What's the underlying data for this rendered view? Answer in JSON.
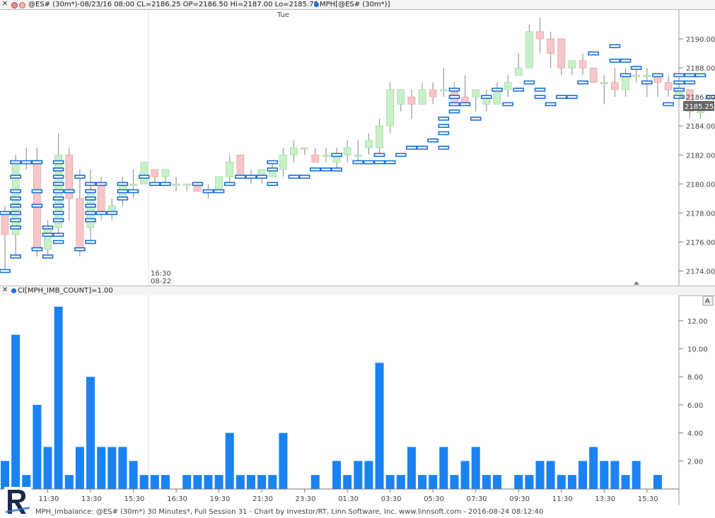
{
  "top_bar": {
    "symbol_info": "@ES# (30m*)-08/23/16 08:00 CL=2186.25 OP=2186.50 Hi=2187.00 Lo=2185.75",
    "indicator_info": "MPH[@ES# (30m*)]"
  },
  "price_panel": {
    "day_label": "Tue",
    "session_time": "16:30",
    "session_date": "08-22",
    "last_price": "2185.25",
    "y_ticks": [
      "2174.00",
      "2176.00",
      "2178.00",
      "2180.00",
      "2182.00",
      "2184.00",
      "2186.00",
      "2188.00",
      "2190.00"
    ]
  },
  "lower_bar": {
    "indicator_label": "CI[MPH_IMB_COUNT]=1.00",
    "auto_button": "A"
  },
  "footer": {
    "text": "MPH_Imbalance: @ES# (30m*) 30 Minutes*, Full Session 31 - Chart by Investor/RT, Linn Software, Inc. www.linnsoft.com - 2016-08-24 08:12:40"
  },
  "colors": {
    "up_candle": "#c8f0c8",
    "down_candle": "#f7c6c8",
    "marker": "#1a6fd8",
    "histogram": "#1a82f2"
  },
  "chart_data": [
    {
      "type": "candlestick",
      "ylim": [
        2173,
        2192
      ],
      "candles": [
        {
          "o": 2178.0,
          "h": 2178.5,
          "l": 2174.0,
          "c": 2176.5
        },
        {
          "o": 2176.5,
          "h": 2182.0,
          "l": 2175.0,
          "c": 2181.5
        },
        {
          "o": 2181.5,
          "h": 2182.5,
          "l": 2181.0,
          "c": 2181.5
        },
        {
          "o": 2181.5,
          "h": 2182.5,
          "l": 2175.0,
          "c": 2175.5
        },
        {
          "o": 2175.5,
          "h": 2177.5,
          "l": 2175.0,
          "c": 2177.0
        },
        {
          "o": 2177.0,
          "h": 2183.5,
          "l": 2176.5,
          "c": 2182.0
        },
        {
          "o": 2182.0,
          "h": 2182.5,
          "l": 2177.5,
          "c": 2179.0
        },
        {
          "o": 2179.0,
          "h": 2181.0,
          "l": 2175.0,
          "c": 2175.5
        },
        {
          "o": 2177.0,
          "h": 2181.0,
          "l": 2176.0,
          "c": 2179.5
        },
        {
          "o": 2180.0,
          "h": 2180.5,
          "l": 2177.5,
          "c": 2178.0
        },
        {
          "o": 2178.0,
          "h": 2179.0,
          "l": 2177.5,
          "c": 2178.5
        },
        {
          "o": 2179.0,
          "h": 2180.5,
          "l": 2178.5,
          "c": 2180.0
        },
        {
          "o": 2180.0,
          "h": 2181.0,
          "l": 2179.0,
          "c": 2180.0
        },
        {
          "o": 2180.0,
          "h": 2181.5,
          "l": 2180.0,
          "c": 2181.5
        },
        {
          "o": 2181.0,
          "h": 2181.0,
          "l": 2180.0,
          "c": 2180.5
        },
        {
          "o": 2180.5,
          "h": 2181.0,
          "l": 2180.0,
          "c": 2181.0
        },
        {
          "o": 2180.0,
          "h": 2180.5,
          "l": 2179.5,
          "c": 2180.0
        },
        {
          "o": 2180.0,
          "h": 2180.0,
          "l": 2179.5,
          "c": 2180.0
        },
        {
          "o": 2180.0,
          "h": 2180.0,
          "l": 2179.5,
          "c": 2179.5
        },
        {
          "o": 2179.5,
          "h": 2180.0,
          "l": 2179.0,
          "c": 2179.5
        },
        {
          "o": 2179.5,
          "h": 2180.5,
          "l": 2179.5,
          "c": 2180.5
        },
        {
          "o": 2180.5,
          "h": 2182.0,
          "l": 2180.0,
          "c": 2181.5
        },
        {
          "o": 2182.0,
          "h": 2182.0,
          "l": 2180.5,
          "c": 2180.5
        },
        {
          "o": 2180.5,
          "h": 2181.0,
          "l": 2180.0,
          "c": 2180.5
        },
        {
          "o": 2180.5,
          "h": 2181.0,
          "l": 2180.0,
          "c": 2181.0
        },
        {
          "o": 2180.5,
          "h": 2181.5,
          "l": 2180.5,
          "c": 2181.0
        },
        {
          "o": 2181.0,
          "h": 2182.5,
          "l": 2180.5,
          "c": 2182.0
        },
        {
          "o": 2182.0,
          "h": 2183.0,
          "l": 2181.5,
          "c": 2182.5
        },
        {
          "o": 2182.5,
          "h": 2182.5,
          "l": 2182.0,
          "c": 2182.5
        },
        {
          "o": 2182.0,
          "h": 2182.5,
          "l": 2181.5,
          "c": 2181.5
        },
        {
          "o": 2182.0,
          "h": 2182.5,
          "l": 2181.5,
          "c": 2182.0
        },
        {
          "o": 2181.5,
          "h": 2182.5,
          "l": 2181.0,
          "c": 2182.0
        },
        {
          "o": 2182.0,
          "h": 2183.0,
          "l": 2181.5,
          "c": 2182.5
        },
        {
          "o": 2182.0,
          "h": 2183.0,
          "l": 2181.5,
          "c": 2182.0
        },
        {
          "o": 2182.5,
          "h": 2183.5,
          "l": 2182.0,
          "c": 2183.0
        },
        {
          "o": 2182.5,
          "h": 2184.5,
          "l": 2182.0,
          "c": 2184.0
        },
        {
          "o": 2184.0,
          "h": 2187.0,
          "l": 2183.5,
          "c": 2186.5
        },
        {
          "o": 2185.5,
          "h": 2186.5,
          "l": 2185.0,
          "c": 2186.5
        },
        {
          "o": 2186.0,
          "h": 2186.5,
          "l": 2184.5,
          "c": 2185.5
        },
        {
          "o": 2185.5,
          "h": 2187.0,
          "l": 2185.5,
          "c": 2186.5
        },
        {
          "o": 2186.5,
          "h": 2187.0,
          "l": 2185.5,
          "c": 2186.0
        },
        {
          "o": 2186.5,
          "h": 2188.0,
          "l": 2186.0,
          "c": 2186.5
        },
        {
          "o": 2186.5,
          "h": 2187.0,
          "l": 2185.5,
          "c": 2185.5
        },
        {
          "o": 2186.0,
          "h": 2187.5,
          "l": 2185.5,
          "c": 2185.5
        },
        {
          "o": 2186.0,
          "h": 2186.5,
          "l": 2185.0,
          "c": 2186.5
        },
        {
          "o": 2185.5,
          "h": 2186.5,
          "l": 2185.0,
          "c": 2186.0
        },
        {
          "o": 2185.5,
          "h": 2187.0,
          "l": 2185.5,
          "c": 2186.5
        },
        {
          "o": 2186.5,
          "h": 2187.5,
          "l": 2186.0,
          "c": 2187.0
        },
        {
          "o": 2187.5,
          "h": 2189.0,
          "l": 2187.5,
          "c": 2188.0
        },
        {
          "o": 2188.0,
          "h": 2191.0,
          "l": 2188.0,
          "c": 2190.5
        },
        {
          "o": 2190.5,
          "h": 2191.5,
          "l": 2189.0,
          "c": 2190.0
        },
        {
          "o": 2190.0,
          "h": 2190.5,
          "l": 2188.0,
          "c": 2189.0
        },
        {
          "o": 2190.0,
          "h": 2190.0,
          "l": 2187.5,
          "c": 2188.0
        },
        {
          "o": 2188.0,
          "h": 2188.5,
          "l": 2187.5,
          "c": 2188.5
        },
        {
          "o": 2188.5,
          "h": 2189.0,
          "l": 2187.5,
          "c": 2188.0
        },
        {
          "o": 2188.0,
          "h": 2188.0,
          "l": 2187.0,
          "c": 2187.0
        },
        {
          "o": 2187.0,
          "h": 2187.5,
          "l": 2185.5,
          "c": 2187.0
        },
        {
          "o": 2187.0,
          "h": 2188.0,
          "l": 2186.0,
          "c": 2186.5
        },
        {
          "o": 2186.5,
          "h": 2188.0,
          "l": 2186.0,
          "c": 2187.5
        },
        {
          "o": 2187.5,
          "h": 2188.0,
          "l": 2187.0,
          "c": 2187.5
        },
        {
          "o": 2187.5,
          "h": 2188.0,
          "l": 2186.0,
          "c": 2187.5
        },
        {
          "o": 2187.5,
          "h": 2187.5,
          "l": 2186.0,
          "c": 2187.0
        },
        {
          "o": 2187.0,
          "h": 2187.5,
          "l": 2186.0,
          "c": 2186.5
        },
        {
          "o": 2186.0,
          "h": 2187.5,
          "l": 2186.0,
          "c": 2186.5
        },
        {
          "o": 2186.5,
          "h": 2186.5,
          "l": 2184.5,
          "c": 2185.0
        },
        {
          "o": 2185.0,
          "h": 2185.5,
          "l": 2184.5,
          "c": 2185.0
        }
      ],
      "markers": [
        [
          2174.0,
          2178.0
        ],
        [
          2175.0,
          2180.5,
          2179.5,
          2179.0,
          2178.5,
          2178.0,
          2177.5,
          2177.0,
          2178.0,
          2181.5
        ],
        [
          2181.5
        ],
        [
          2175.5,
          2175.5,
          2178.5,
          2179.5,
          2181.5,
          2181.5
        ],
        [
          2175.0,
          2177.0,
          2176.5
        ],
        [
          2176.0,
          2176.5,
          2178.0,
          2177.5,
          2178.5,
          2179.0,
          2179.5,
          2180.0,
          2180.5,
          2181.0,
          2181.5
        ],
        [
          2179.5
        ],
        [
          2175.5,
          2180.5
        ],
        [
          2176.0,
          2177.5,
          2178.0,
          2178.5,
          2179.0,
          2179.5,
          2180.0
        ],
        [
          2178.0,
          2180.0
        ],
        [
          2178.0
        ],
        [
          2179.0,
          2179.5,
          2180.0
        ],
        [
          2179.5
        ],
        [
          2180.5
        ],
        [
          2180.0
        ],
        [
          2180.0
        ],
        [],
        [],
        [
          2180.0
        ],
        [
          2179.5
        ],
        [
          2179.5
        ],
        [
          2180.0
        ],
        [
          2180.5
        ],
        [
          2180.5
        ],
        [
          2180.5
        ],
        [
          2180.0,
          2181.0,
          2181.5
        ],
        [],
        [
          2180.5
        ],
        [
          2180.5
        ],
        [
          2181.0
        ],
        [
          2181.0
        ],
        [
          2181.0,
          2182.0
        ],
        [],
        [
          2181.5
        ],
        [
          2181.5
        ],
        [
          2181.5,
          2182.0
        ],
        [
          2181.5
        ],
        [
          2182.0
        ],
        [
          2182.5
        ],
        [
          2182.5
        ],
        [
          2183.0
        ],
        [
          2182.5,
          2183.5,
          2184.0,
          2184.5
        ],
        [
          2185.0,
          2185.5,
          2186.0,
          2186.5
        ],
        [
          2185.5
        ],
        [
          2184.5
        ],
        [
          2186.0
        ],
        [
          2186.5
        ],
        [
          2185.5
        ],
        [
          2186.5
        ],
        [
          2187.0
        ],
        [
          2186.0,
          2186.5
        ],
        [
          2185.5
        ],
        [
          2186.0
        ],
        [
          2186.0
        ],
        [
          2187.0
        ],
        [
          2189.0
        ],
        [],
        [
          2188.5,
          2189.5
        ],
        [
          2187.5,
          2188.5
        ],
        [
          2188.0
        ],
        [
          2187.0
        ],
        [
          2187.5
        ],
        [
          2185.5
        ],
        [
          2186.5,
          2186.0,
          2187.0,
          2187.5
        ],
        [
          2187.0,
          2187.5
        ],
        [
          2187.5
        ],
        [
          2186.0
        ],
        [
          2186.0
        ],
        [
          2186.0,
          2186.5
        ],
        [
          2184.5
        ]
      ]
    },
    {
      "type": "bar",
      "title": "CI[MPH_IMB_COUNT]",
      "ylim": [
        0,
        13
      ],
      "y_ticks": [
        2,
        4,
        6,
        8,
        10,
        12
      ],
      "x_tick_labels": [
        "11:30",
        "13:30",
        "15:30",
        "16:30",
        "19:30",
        "21:30",
        "23:30",
        "01:30",
        "03:30",
        "05:30",
        "07:30",
        "09:30",
        "11:30",
        "13:30",
        "15:30"
      ],
      "values": [
        2,
        11,
        1,
        6,
        3,
        13,
        1,
        3,
        8,
        3,
        3,
        3,
        2,
        1,
        1,
        1,
        0,
        1,
        1,
        1,
        1,
        4,
        1,
        1,
        1,
        1,
        4,
        0,
        0,
        1,
        0,
        2,
        1,
        2,
        2,
        9,
        1,
        1,
        3,
        1,
        1,
        3,
        1,
        2,
        3,
        1,
        1,
        0,
        1,
        1,
        2,
        2,
        1,
        1,
        2,
        3,
        2,
        2,
        1,
        2,
        0,
        1,
        0,
        0,
        0,
        0
      ]
    }
  ]
}
